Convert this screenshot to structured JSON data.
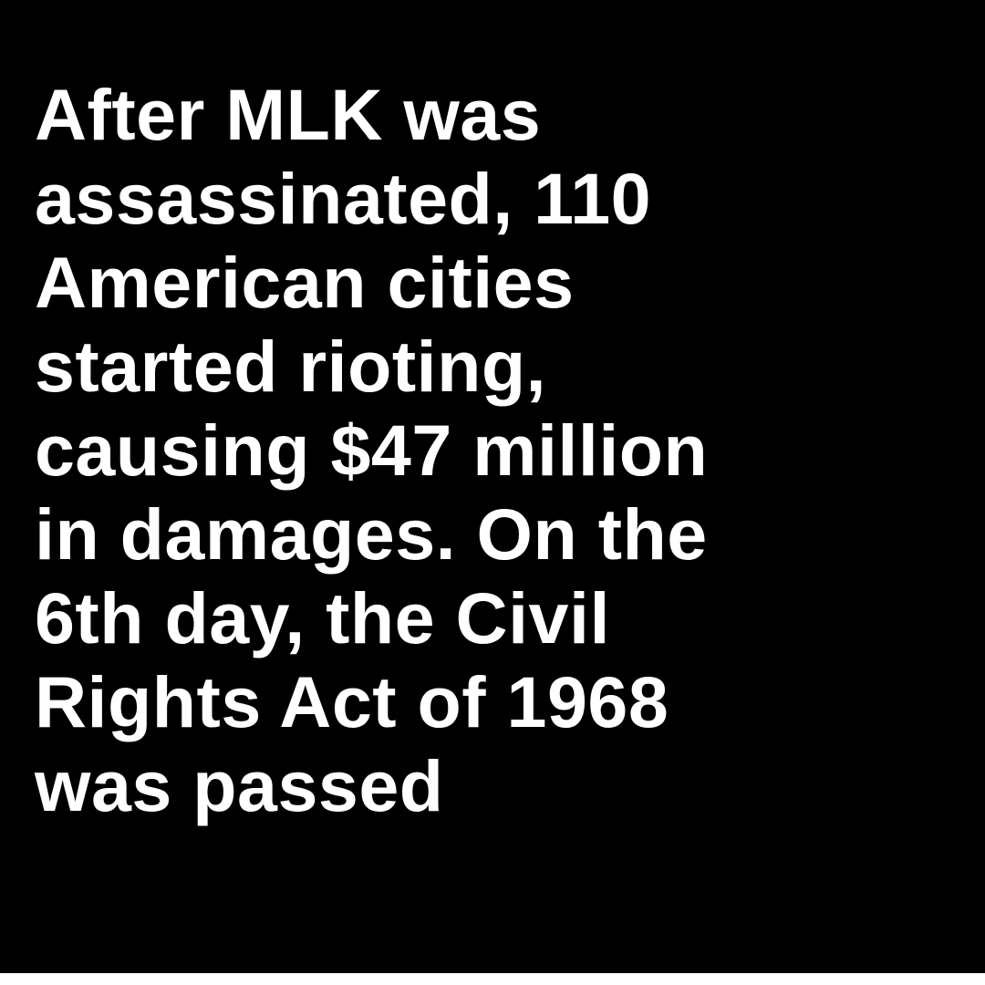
{
  "colors": {
    "background": "#000000",
    "text": "#ffffff",
    "border": "#ffffff"
  },
  "lines": [
    "After MLK was",
    "assassinated, 110",
    "American cities",
    "started rioting,",
    "causing $47 million",
    "in damages. On the",
    "6th day, the Civil",
    "Rights Act of 1968",
    "was passed"
  ]
}
